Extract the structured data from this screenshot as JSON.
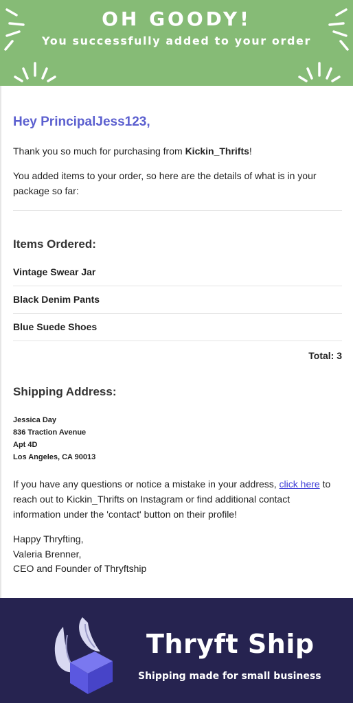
{
  "header": {
    "title": "OH GOODY!",
    "subtitle": "You successfully added to your order",
    "background": "#86bb76"
  },
  "greeting": "Hey PrincipalJess123,",
  "intro": {
    "thanks_prefix": "Thank you so much for purchasing from ",
    "shop_name": "Kickin_Thrifts",
    "thanks_suffix": "!",
    "added_text": "You added items to your order, so here are the details of what is in your package so far:"
  },
  "items_section": {
    "heading": "Items Ordered:",
    "items": [
      "Vintage Swear Jar",
      "Black Denim Pants",
      "Blue Suede Shoes"
    ],
    "total_label": "Total: 3"
  },
  "shipping": {
    "heading": "Shipping Address:",
    "name": "Jessica Day",
    "street": "836 Traction Avenue",
    "unit": "Apt 4D",
    "city_line": "Los Angeles, CA 90013"
  },
  "contact": {
    "prefix": "If you have any questions or notice a mistake in your address, ",
    "link_text": "click here",
    "suffix": " to reach out to Kickin_Thrifts on Instagram or find additional contact information under the 'contact' button on their profile!"
  },
  "signoff": {
    "line1": "Happy Thryfting,",
    "line2": "Valeria Brenner,",
    "line3": "CEO and Founder of Thryftship"
  },
  "footer": {
    "brand": "Thryft Ship",
    "tagline": "Shipping made for small business",
    "logo_icon": "winged-box-icon",
    "background": "#262350"
  },
  "colors": {
    "greeting": "#5b5fcf",
    "link": "#3d3dd6"
  }
}
